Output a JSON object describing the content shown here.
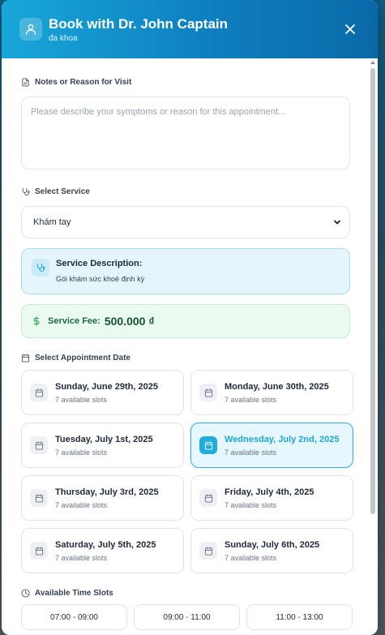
{
  "header": {
    "title": "Book with Dr. John Captain",
    "subtitle": "đa khoa"
  },
  "notes": {
    "label": "Notes or Reason for Visit",
    "placeholder": "Please describe your symptoms or reason for this appointment..."
  },
  "service": {
    "label": "Select Service",
    "selected": "Khám tay",
    "description_title": "Service Description:",
    "description_text": "Gói khám sức khoẻ định kỳ",
    "fee_label": "Service Fee:",
    "fee_value": "500.000 ₫"
  },
  "dates": {
    "label": "Select Appointment Date",
    "items": [
      {
        "name": "Sunday, June 29th, 2025",
        "slots": "7 available slots"
      },
      {
        "name": "Monday, June 30th, 2025",
        "slots": "7 available slots"
      },
      {
        "name": "Tuesday, July 1st, 2025",
        "slots": "7 available slots"
      },
      {
        "name": "Wednesday, July 2nd, 2025",
        "slots": "7 available slots"
      },
      {
        "name": "Thursday, July 3rd, 2025",
        "slots": "7 available slots"
      },
      {
        "name": "Friday, July 4th, 2025",
        "slots": "7 available slots"
      },
      {
        "name": "Saturday, July 5th, 2025",
        "slots": "7 available slots"
      },
      {
        "name": "Sunday, July 6th, 2025",
        "slots": "7 available slots"
      }
    ],
    "selected_index": 3
  },
  "times": {
    "label": "Available Time Slots",
    "items": [
      "07:00 - 09:00",
      "09:00 - 11:00",
      "11:00 - 13:00"
    ]
  },
  "colors": {
    "accent": "#1ba7d6",
    "header_start": "#18a7d8",
    "header_end": "#0a6aa8",
    "fee_green": "#14532d"
  },
  "icons": {
    "header": "user-icon",
    "close": "close-icon",
    "notes": "document-icon",
    "service": "stethoscope-icon",
    "fee": "dollar-icon",
    "date": "calendar-icon",
    "time": "clock-icon"
  }
}
